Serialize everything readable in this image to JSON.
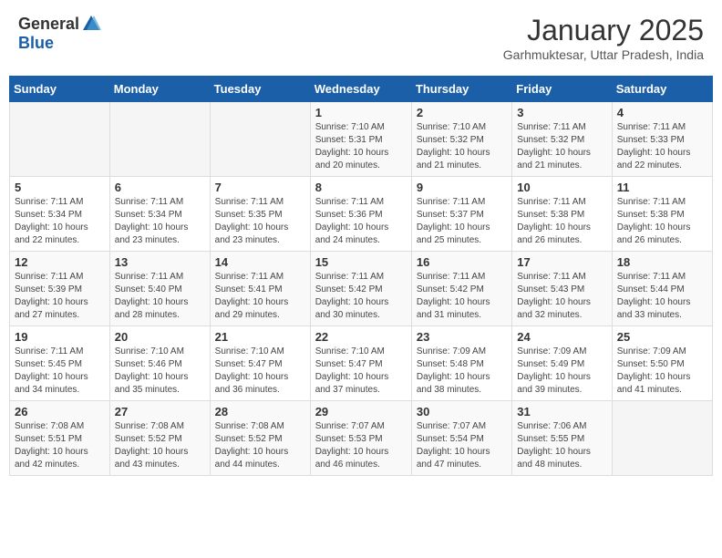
{
  "header": {
    "logo_general": "General",
    "logo_blue": "Blue",
    "month_title": "January 2025",
    "location": "Garhmuktesar, Uttar Pradesh, India"
  },
  "days_of_week": [
    "Sunday",
    "Monday",
    "Tuesday",
    "Wednesday",
    "Thursday",
    "Friday",
    "Saturday"
  ],
  "weeks": [
    [
      {
        "day": "",
        "info": ""
      },
      {
        "day": "",
        "info": ""
      },
      {
        "day": "",
        "info": ""
      },
      {
        "day": "1",
        "info": "Sunrise: 7:10 AM\nSunset: 5:31 PM\nDaylight: 10 hours\nand 20 minutes."
      },
      {
        "day": "2",
        "info": "Sunrise: 7:10 AM\nSunset: 5:32 PM\nDaylight: 10 hours\nand 21 minutes."
      },
      {
        "day": "3",
        "info": "Sunrise: 7:11 AM\nSunset: 5:32 PM\nDaylight: 10 hours\nand 21 minutes."
      },
      {
        "day": "4",
        "info": "Sunrise: 7:11 AM\nSunset: 5:33 PM\nDaylight: 10 hours\nand 22 minutes."
      }
    ],
    [
      {
        "day": "5",
        "info": "Sunrise: 7:11 AM\nSunset: 5:34 PM\nDaylight: 10 hours\nand 22 minutes."
      },
      {
        "day": "6",
        "info": "Sunrise: 7:11 AM\nSunset: 5:34 PM\nDaylight: 10 hours\nand 23 minutes."
      },
      {
        "day": "7",
        "info": "Sunrise: 7:11 AM\nSunset: 5:35 PM\nDaylight: 10 hours\nand 23 minutes."
      },
      {
        "day": "8",
        "info": "Sunrise: 7:11 AM\nSunset: 5:36 PM\nDaylight: 10 hours\nand 24 minutes."
      },
      {
        "day": "9",
        "info": "Sunrise: 7:11 AM\nSunset: 5:37 PM\nDaylight: 10 hours\nand 25 minutes."
      },
      {
        "day": "10",
        "info": "Sunrise: 7:11 AM\nSunset: 5:38 PM\nDaylight: 10 hours\nand 26 minutes."
      },
      {
        "day": "11",
        "info": "Sunrise: 7:11 AM\nSunset: 5:38 PM\nDaylight: 10 hours\nand 26 minutes."
      }
    ],
    [
      {
        "day": "12",
        "info": "Sunrise: 7:11 AM\nSunset: 5:39 PM\nDaylight: 10 hours\nand 27 minutes."
      },
      {
        "day": "13",
        "info": "Sunrise: 7:11 AM\nSunset: 5:40 PM\nDaylight: 10 hours\nand 28 minutes."
      },
      {
        "day": "14",
        "info": "Sunrise: 7:11 AM\nSunset: 5:41 PM\nDaylight: 10 hours\nand 29 minutes."
      },
      {
        "day": "15",
        "info": "Sunrise: 7:11 AM\nSunset: 5:42 PM\nDaylight: 10 hours\nand 30 minutes."
      },
      {
        "day": "16",
        "info": "Sunrise: 7:11 AM\nSunset: 5:42 PM\nDaylight: 10 hours\nand 31 minutes."
      },
      {
        "day": "17",
        "info": "Sunrise: 7:11 AM\nSunset: 5:43 PM\nDaylight: 10 hours\nand 32 minutes."
      },
      {
        "day": "18",
        "info": "Sunrise: 7:11 AM\nSunset: 5:44 PM\nDaylight: 10 hours\nand 33 minutes."
      }
    ],
    [
      {
        "day": "19",
        "info": "Sunrise: 7:11 AM\nSunset: 5:45 PM\nDaylight: 10 hours\nand 34 minutes."
      },
      {
        "day": "20",
        "info": "Sunrise: 7:10 AM\nSunset: 5:46 PM\nDaylight: 10 hours\nand 35 minutes."
      },
      {
        "day": "21",
        "info": "Sunrise: 7:10 AM\nSunset: 5:47 PM\nDaylight: 10 hours\nand 36 minutes."
      },
      {
        "day": "22",
        "info": "Sunrise: 7:10 AM\nSunset: 5:47 PM\nDaylight: 10 hours\nand 37 minutes."
      },
      {
        "day": "23",
        "info": "Sunrise: 7:09 AM\nSunset: 5:48 PM\nDaylight: 10 hours\nand 38 minutes."
      },
      {
        "day": "24",
        "info": "Sunrise: 7:09 AM\nSunset: 5:49 PM\nDaylight: 10 hours\nand 39 minutes."
      },
      {
        "day": "25",
        "info": "Sunrise: 7:09 AM\nSunset: 5:50 PM\nDaylight: 10 hours\nand 41 minutes."
      }
    ],
    [
      {
        "day": "26",
        "info": "Sunrise: 7:08 AM\nSunset: 5:51 PM\nDaylight: 10 hours\nand 42 minutes."
      },
      {
        "day": "27",
        "info": "Sunrise: 7:08 AM\nSunset: 5:52 PM\nDaylight: 10 hours\nand 43 minutes."
      },
      {
        "day": "28",
        "info": "Sunrise: 7:08 AM\nSunset: 5:52 PM\nDaylight: 10 hours\nand 44 minutes."
      },
      {
        "day": "29",
        "info": "Sunrise: 7:07 AM\nSunset: 5:53 PM\nDaylight: 10 hours\nand 46 minutes."
      },
      {
        "day": "30",
        "info": "Sunrise: 7:07 AM\nSunset: 5:54 PM\nDaylight: 10 hours\nand 47 minutes."
      },
      {
        "day": "31",
        "info": "Sunrise: 7:06 AM\nSunset: 5:55 PM\nDaylight: 10 hours\nand 48 minutes."
      },
      {
        "day": "",
        "info": ""
      }
    ]
  ]
}
